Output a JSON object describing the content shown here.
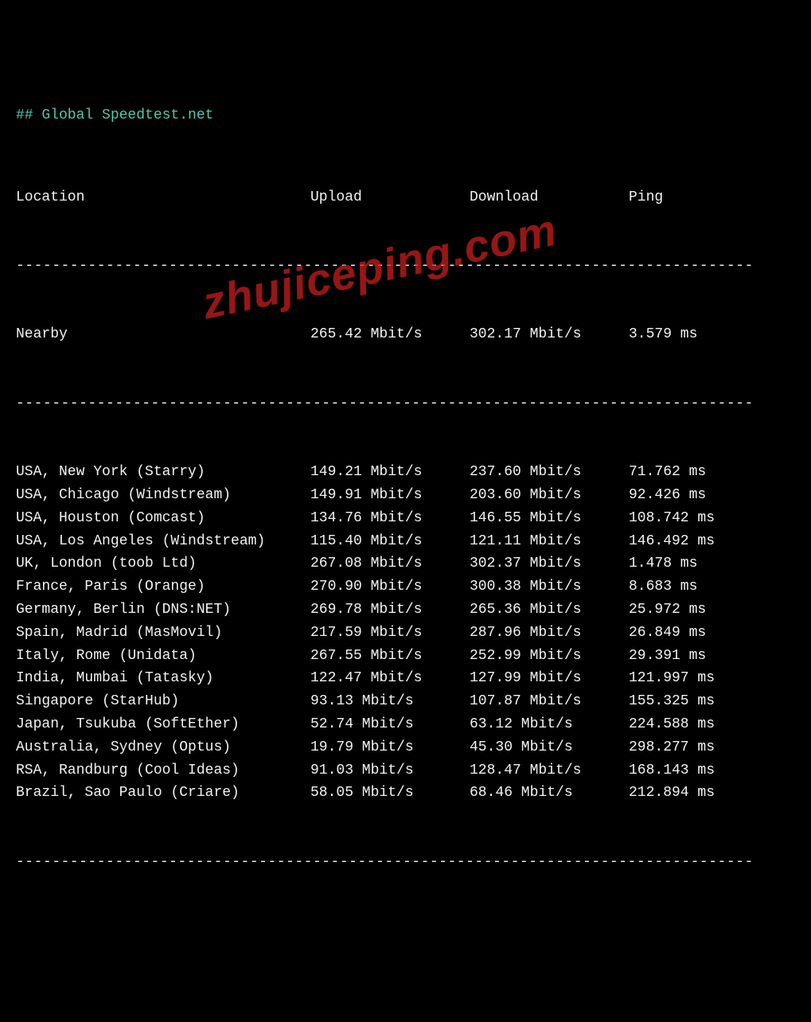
{
  "title": "## Global Speedtest.net",
  "headers": {
    "location": "Location",
    "upload": "Upload",
    "download": "Download",
    "ping": "Ping"
  },
  "divider1": "----------------------------------------------------------------------------------",
  "nearby": {
    "location": "Nearby",
    "upload": "265.42 Mbit/s",
    "download": "302.17 Mbit/s",
    "ping": "3.579 ms"
  },
  "divider2": "----------------------------------------------------------------------------------",
  "rows": [
    {
      "location": "USA, New York (Starry)",
      "upload": "149.21 Mbit/s",
      "download": "237.60 Mbit/s",
      "ping": "71.762 ms"
    },
    {
      "location": "USA, Chicago (Windstream)",
      "upload": "149.91 Mbit/s",
      "download": "203.60 Mbit/s",
      "ping": "92.426 ms"
    },
    {
      "location": "USA, Houston (Comcast)",
      "upload": "134.76 Mbit/s",
      "download": "146.55 Mbit/s",
      "ping": "108.742 ms"
    },
    {
      "location": "USA, Los Angeles (Windstream)",
      "upload": "115.40 Mbit/s",
      "download": "121.11 Mbit/s",
      "ping": "146.492 ms"
    },
    {
      "location": "UK, London (toob Ltd)",
      "upload": "267.08 Mbit/s",
      "download": "302.37 Mbit/s",
      "ping": "1.478 ms"
    },
    {
      "location": "France, Paris (Orange)",
      "upload": "270.90 Mbit/s",
      "download": "300.38 Mbit/s",
      "ping": "8.683 ms"
    },
    {
      "location": "Germany, Berlin (DNS:NET)",
      "upload": "269.78 Mbit/s",
      "download": "265.36 Mbit/s",
      "ping": "25.972 ms"
    },
    {
      "location": "Spain, Madrid (MasMovil)",
      "upload": "217.59 Mbit/s",
      "download": "287.96 Mbit/s",
      "ping": "26.849 ms"
    },
    {
      "location": "Italy, Rome (Unidata)",
      "upload": "267.55 Mbit/s",
      "download": "252.99 Mbit/s",
      "ping": "29.391 ms"
    },
    {
      "location": "India, Mumbai (Tatasky)",
      "upload": "122.47 Mbit/s",
      "download": "127.99 Mbit/s",
      "ping": "121.997 ms"
    },
    {
      "location": "Singapore (StarHub)",
      "upload": "93.13 Mbit/s",
      "download": "107.87 Mbit/s",
      "ping": "155.325 ms"
    },
    {
      "location": "Japan, Tsukuba (SoftEther)",
      "upload": "52.74 Mbit/s",
      "download": "63.12 Mbit/s",
      "ping": "224.588 ms"
    },
    {
      "location": "Australia, Sydney (Optus)",
      "upload": "19.79 Mbit/s",
      "download": "45.30 Mbit/s",
      "ping": "298.277 ms"
    },
    {
      "location": "RSA, Randburg (Cool Ideas)",
      "upload": "91.03 Mbit/s",
      "download": "128.47 Mbit/s",
      "ping": "168.143 ms"
    },
    {
      "location": "Brazil, Sao Paulo (Criare)",
      "upload": "58.05 Mbit/s",
      "download": "68.46 Mbit/s",
      "ping": "212.894 ms"
    }
  ],
  "divider3": "----------------------------------------------------------------------------------",
  "watermark": "zhujiceping.com"
}
